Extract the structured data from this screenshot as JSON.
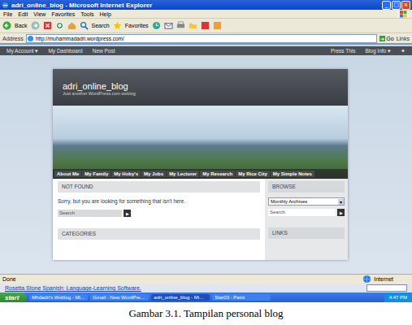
{
  "window": {
    "title": "adri_online_blog - Microsoft Internet Explorer",
    "controls": [
      "_",
      "□",
      "×"
    ]
  },
  "menu": [
    "File",
    "Edit",
    "View",
    "Favorites",
    "Tools",
    "Help"
  ],
  "toolbar": {
    "back": "Back",
    "search": "Search",
    "favorites": "Favorites"
  },
  "address": {
    "label": "Address",
    "url": "http://muhammadadri.wordpress.com/",
    "go": "Go",
    "links": "Links"
  },
  "admin_bar": {
    "left": [
      "My Account ▾",
      "My Dashboard",
      "New Post"
    ],
    "right": [
      "Press This",
      "Blog Info ▾",
      "✦"
    ]
  },
  "blog": {
    "title": "adri_online_blog",
    "tagline": "Just another WordPress.com weblog",
    "nav": [
      "About Me",
      "My Family",
      "My Hoby's",
      "My Jobs",
      "My Lecturer",
      "My Research",
      "My Rice City",
      "My Simple Notes"
    ],
    "main": {
      "heading": "NOT FOUND",
      "message": "Sorry, but you are looking for something that isn't here.",
      "search": "Search",
      "search_button": "▶",
      "categories": "CATEGORIES"
    },
    "sidebar": {
      "browse": "BROWSE",
      "archives": "Monthly Archives",
      "search": "Search",
      "search_button": "▶",
      "links": "LINKS"
    }
  },
  "status_bar": {
    "text": "Done",
    "zone": "Internet"
  },
  "ad": {
    "text": "Rosetta Stone Spanish: Language-Learning Software."
  },
  "taskbar": {
    "start": "start",
    "items": [
      {
        "label": "Mhdadri's Weblog - Mi...",
        "selected": false
      },
      {
        "label": "Gmail - New WordPre...",
        "selected": false
      },
      {
        "label": "adri_online_blog - Mi...",
        "selected": true
      },
      {
        "label": "Star03 - Paint",
        "selected": false
      }
    ],
    "clock": "4:47 PM"
  },
  "caption": "Gambar 3.1. Tampilan personal blog"
}
